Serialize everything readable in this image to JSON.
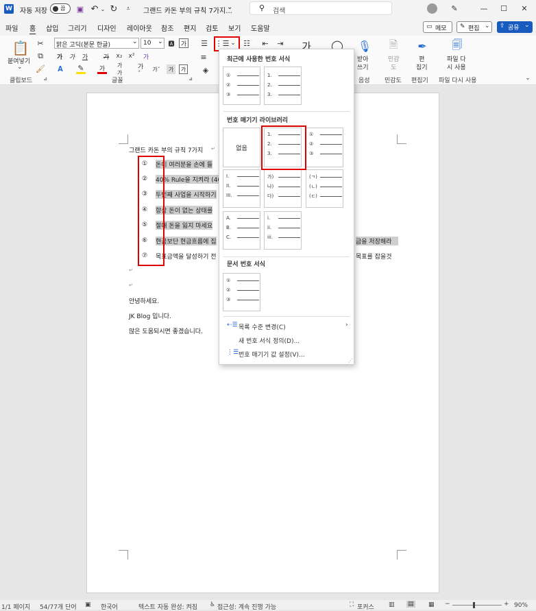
{
  "titlebar": {
    "autosave": "자동 저장",
    "toggle": "끔",
    "doc_title": "그랜드 카돈 부의 규칙 7가지...",
    "title_chevron": "⌄",
    "search": "검색"
  },
  "menu": {
    "items": [
      "파일",
      "홈",
      "삽입",
      "그리기",
      "디자인",
      "레이아웃",
      "참조",
      "편지",
      "검토",
      "보기",
      "도움말"
    ],
    "memo": "메모",
    "edit": "편집",
    "share": "공유"
  },
  "ribbon": {
    "paste": "붙여넣기",
    "font_name": "맑은 고딕(본문 한글)",
    "font_size": "10",
    "find": "받아\n쓰기",
    "sensitivity": "민감\n도",
    "editor": "편\n집기",
    "reuse": "파일 다\n시 사용",
    "groups": {
      "clipboard": "클립보드",
      "font": "글꼴",
      "voice": "음성",
      "sensitivity": "민감도",
      "editor": "편집기",
      "reuse": "파일 다시 사용"
    }
  },
  "document": {
    "title": "그랜드 카돈 부의 규칙 7가지",
    "items": [
      {
        "num": "①",
        "text": "돈이 여러분을 손에 들"
      },
      {
        "num": "②",
        "text": "40% Rule을 지켜라 (40"
      },
      {
        "num": "③",
        "text": "두번째 사업을 시작하기"
      },
      {
        "num": "④",
        "text": "항상 돈이 없는 상태를"
      },
      {
        "num": "⑤",
        "text": "절대 돈을 잃지 마세요"
      },
      {
        "num": "⑥",
        "text": "현금보단 현금흐름에 집"
      },
      {
        "num": "⑦",
        "text": "목표금액을 달성하기 전"
      }
    ],
    "item6_tail": "금을 저장해라",
    "item7_tail": "목표를 잡을것",
    "para_mark": "↵",
    "lines": [
      "안녕하세요.",
      "JK Blog 입니다.",
      "많은 도움되시면 좋겠습니다."
    ]
  },
  "dropdown": {
    "recent_title": "최근에 사용한 번호 서식",
    "library_title": "번호 매기기 라이브러리",
    "doc_title": "문서 번호 서식",
    "none": "없음",
    "recent": [
      [
        "①",
        "②",
        "③"
      ],
      [
        "1.",
        "2.",
        "3."
      ]
    ],
    "library": [
      [
        "1.",
        "2.",
        "3."
      ],
      [
        "①",
        "②",
        "③"
      ],
      [
        "I.",
        "II.",
        "III."
      ],
      [
        "가)",
        "나)",
        "다)"
      ],
      [
        "(ㄱ)",
        "(ㄴ)",
        "(ㄷ)"
      ],
      [
        "A.",
        "B.",
        "C."
      ],
      [
        "i.",
        "ii.",
        "iii."
      ]
    ],
    "docfmt": [
      "①",
      "②",
      "③"
    ],
    "menu": [
      "목록 수준 변경(C)",
      "새 번호 서식 정의(D)...",
      "번호 매기기 값 설정(V)..."
    ]
  },
  "status": {
    "page": "1/1 페이지",
    "words": "54/77개 단어",
    "lang": "한국어",
    "autocomplete": "텍스트 자동 완성: 켜짐",
    "access": "접근성: 계속 진행 가능",
    "focus": "포커스",
    "zoom": "90%"
  }
}
